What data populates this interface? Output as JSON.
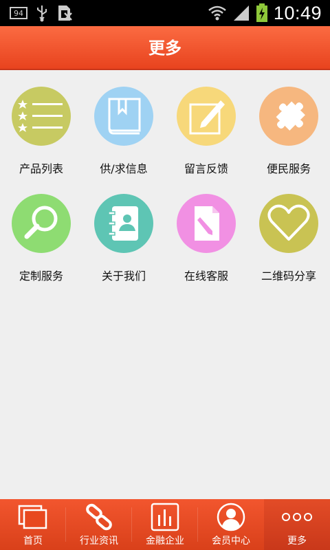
{
  "status_bar": {
    "battery_badge": "94",
    "time": "10:49"
  },
  "header": {
    "title": "更多"
  },
  "grid": {
    "items": [
      {
        "label": "产品列表",
        "icon": "list-icon",
        "color": "#c7ca62"
      },
      {
        "label": "供/求信息",
        "icon": "book-icon",
        "color": "#9fd2f3"
      },
      {
        "label": "留言反馈",
        "icon": "edit-icon",
        "color": "#f7d87a"
      },
      {
        "label": "便民服务",
        "icon": "puzzle-icon",
        "color": "#f6b77f"
      },
      {
        "label": "定制服务",
        "icon": "search-icon",
        "color": "#8edc72"
      },
      {
        "label": "关于我们",
        "icon": "contact-book-icon",
        "color": "#5ec5b4"
      },
      {
        "label": "在线客服",
        "icon": "document-edit-icon",
        "color": "#f190e3"
      },
      {
        "label": "二维码分享",
        "icon": "heart-icon",
        "color": "#c9c353"
      }
    ]
  },
  "bottom_nav": {
    "items": [
      {
        "label": "首页",
        "icon": "home-icon"
      },
      {
        "label": "行业资讯",
        "icon": "link-icon"
      },
      {
        "label": "金融企业",
        "icon": "chart-icon"
      },
      {
        "label": "会员中心",
        "icon": "user-icon"
      },
      {
        "label": "更多",
        "icon": "more-icon",
        "active": true
      }
    ]
  }
}
